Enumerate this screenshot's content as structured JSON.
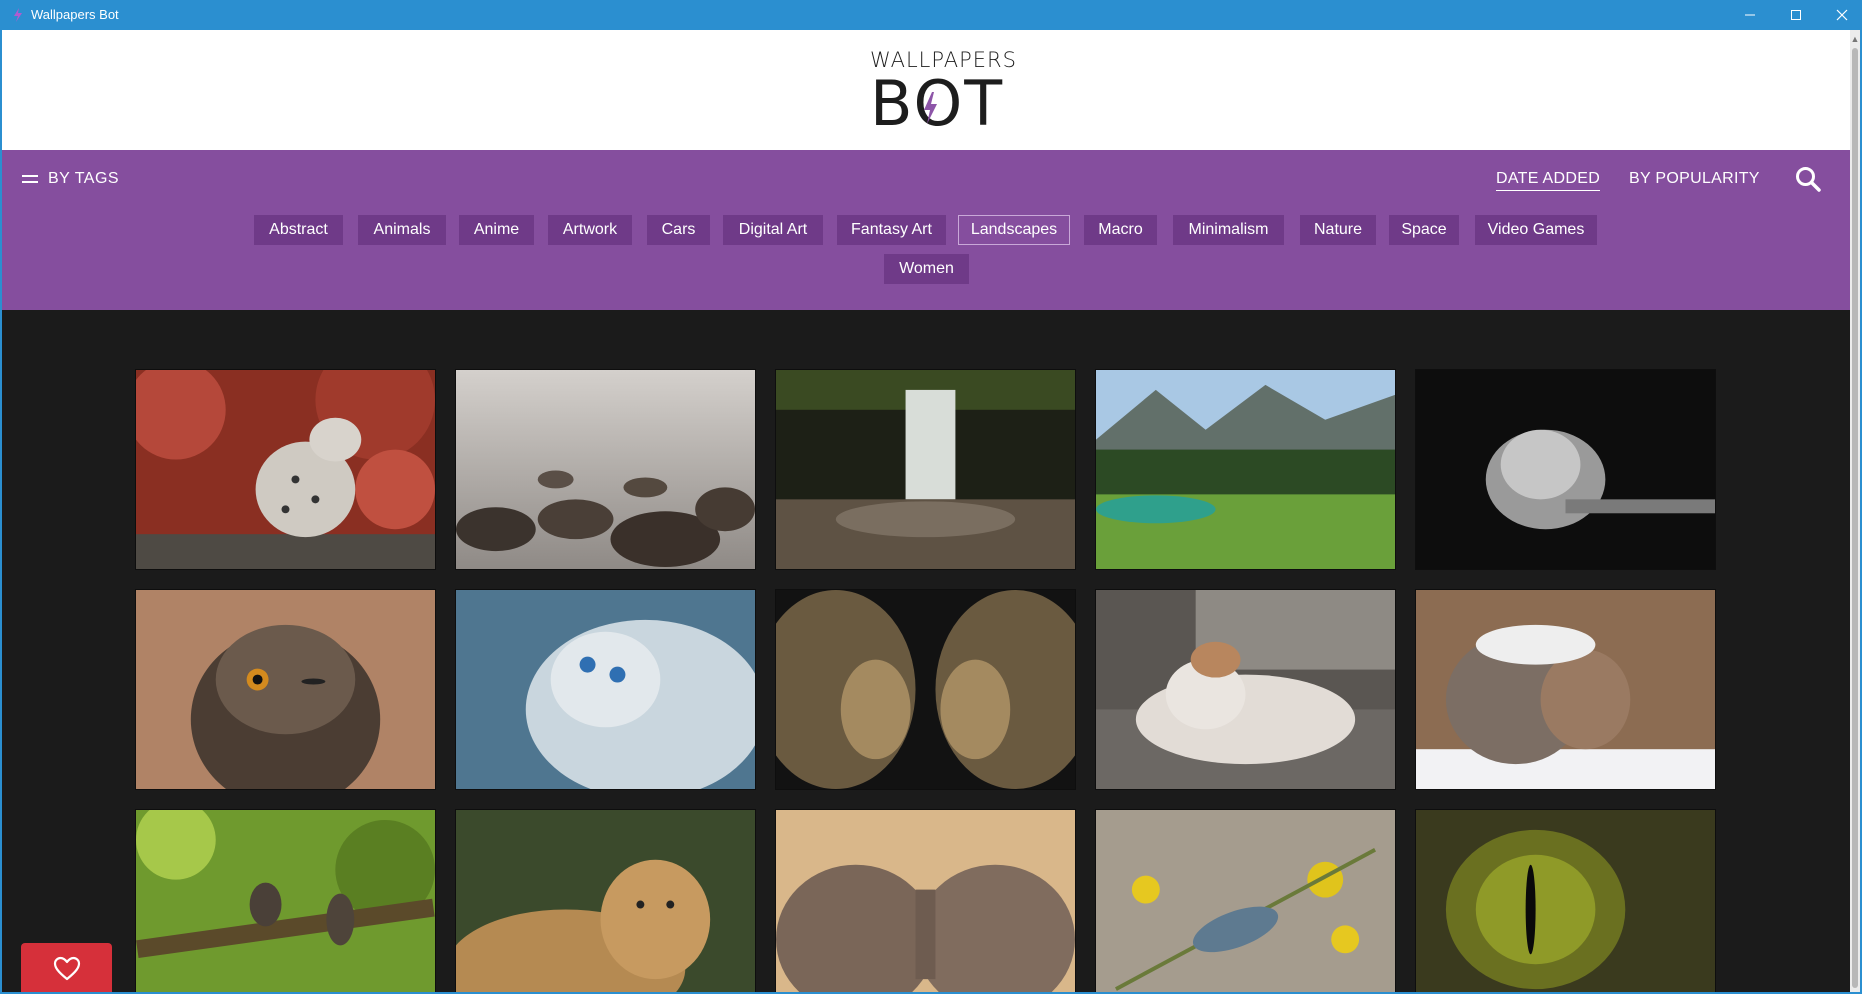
{
  "window": {
    "title": "Wallpapers Bot",
    "controls": [
      "minimize",
      "maximize",
      "close"
    ]
  },
  "logo": {
    "top_text": "WALLPAPERS",
    "main_text": "BOT"
  },
  "nav": {
    "by_tags_label": "BY TAGS",
    "sort_date_label": "DATE ADDED",
    "sort_popularity_label": "BY POPULARITY",
    "active_sort": "DATE ADDED"
  },
  "tags": [
    "Abstract",
    "Animals",
    "Anime",
    "Artwork",
    "Cars",
    "Digital Art",
    "Fantasy Art",
    "Landscapes",
    "Macro",
    "Minimalism",
    "Nature",
    "Space",
    "Video Games",
    "Women"
  ],
  "active_tag": "Landscapes",
  "thumbnails": [
    "snow-leopard",
    "misty-rocks",
    "waterfall",
    "mountain-lake-meadow",
    "black-white-cat",
    "owl",
    "white-kitten",
    "mirrored-lions",
    "resting-cat",
    "snowy-squirrel",
    "birds-on-branch",
    "cheetah",
    "elephants",
    "blue-bird-flowers",
    "reptile-eye"
  ],
  "colors": {
    "titlebar": "#2b8fd0",
    "nav": "#854e9e",
    "tag_bg": "#6f3a88",
    "content_bg": "#1b1b1b",
    "favorite": "#d6303a"
  }
}
